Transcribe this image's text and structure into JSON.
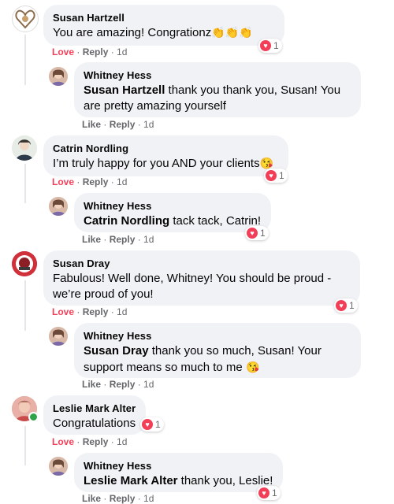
{
  "comments": [
    {
      "author": "Susan Hartzell",
      "text": "You are amazing! Congrationz",
      "emojis": "👏👏👏",
      "actions": {
        "love": "Love",
        "reply": "Reply",
        "time": "1d"
      },
      "reaction_count": "1",
      "reply": {
        "author": "Whitney Hess",
        "mention": "Susan Hartzell",
        "text_line1": " thank you thank you, Susan! You",
        "text_line2": "are pretty amazing yourself",
        "actions": {
          "like": "Like",
          "reply": "Reply",
          "time": "1d"
        }
      }
    },
    {
      "author": "Catrin Nordling",
      "text": "I’m truly happy for you AND your clients",
      "emojis": "😘",
      "actions": {
        "love": "Love",
        "reply": "Reply",
        "time": "1d"
      },
      "reaction_count": "1",
      "reply": {
        "author": "Whitney Hess",
        "mention": "Catrin Nordling",
        "text_line1": " tack tack, Catrin!",
        "actions": {
          "like": "Like",
          "reply": "Reply",
          "time": "1d"
        },
        "reaction_count": "1"
      }
    },
    {
      "author": "Susan Dray",
      "text_line1": "Fabulous! Well done, Whitney! You should be proud -",
      "text_line2": "we’re proud of you!",
      "actions": {
        "love": "Love",
        "reply": "Reply",
        "time": "1d"
      },
      "reaction_count": "1",
      "reply": {
        "author": "Whitney Hess",
        "mention": "Susan Dray",
        "text_line1": " thank you so much, Susan! Your",
        "text_line2": "support means so much to me",
        "emojis": "😘",
        "actions": {
          "like": "Like",
          "reply": "Reply",
          "time": "1d"
        }
      }
    },
    {
      "author": "Leslie Mark Alter",
      "text": "Congratulations",
      "actions": {
        "love": "Love",
        "reply": "Reply",
        "time": "1d"
      },
      "reaction_count": "1",
      "reply": {
        "author": "Whitney Hess",
        "mention": "Leslie Mark Alter",
        "text_line1": " thank you, Leslie!",
        "actions": {
          "like": "Like",
          "reply": "Reply",
          "time": "1d"
        },
        "reaction_count": "1"
      }
    }
  ],
  "colors": {
    "love": "#f33e58",
    "bubble": "#f0f2f5",
    "meta": "#65676b",
    "online": "#31a24c"
  },
  "icons": {
    "reaction": "heart-icon",
    "online": "online-status-icon"
  }
}
